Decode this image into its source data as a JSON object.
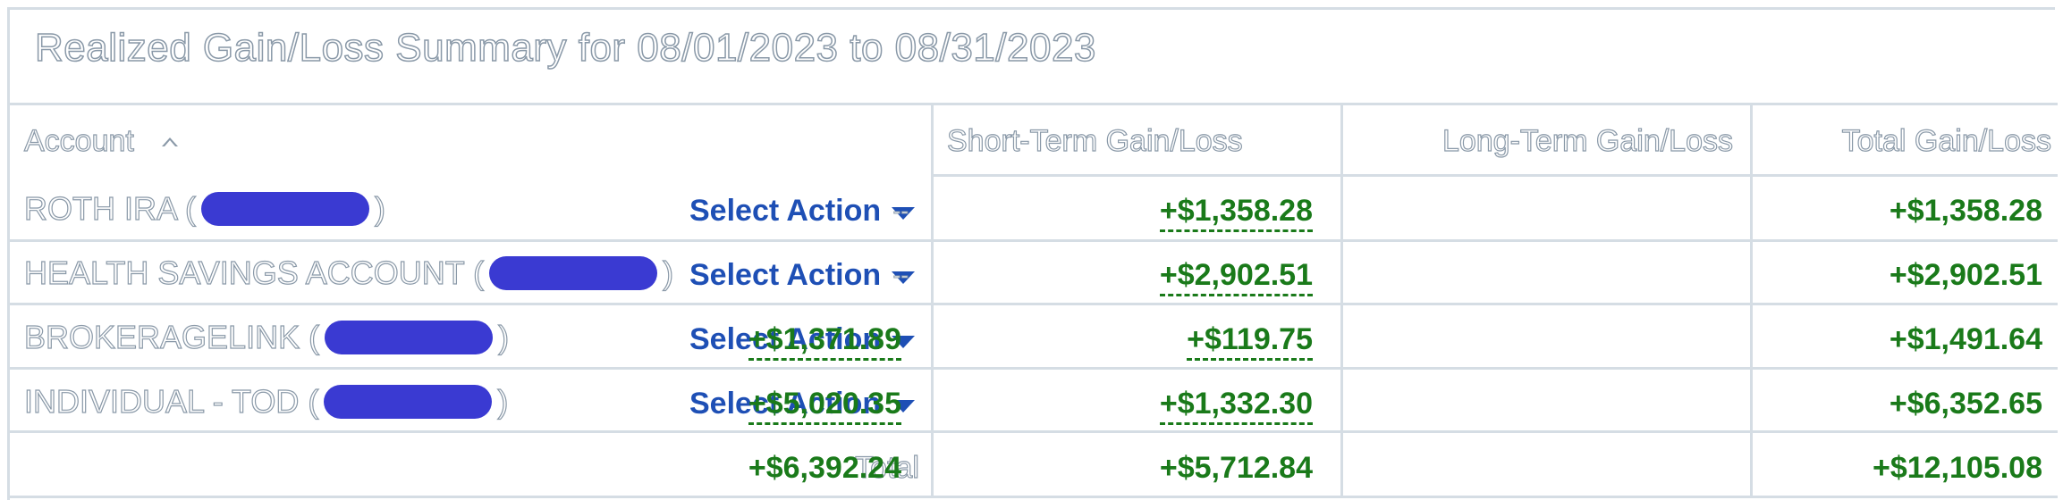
{
  "summary": {
    "title": "Realized Gain/Loss Summary for 08/01/2023 to 08/31/2023"
  },
  "table": {
    "headers": {
      "account": "Account",
      "short_term": "Short-Term Gain/Loss",
      "long_term": "Long-Term Gain/Loss",
      "total": "Total Gain/Loss"
    },
    "sort_icon": "caret-up-icon",
    "select_action_label": "Select Action",
    "rows": [
      {
        "account_name": "ROTH IRA (",
        "account_close": ")",
        "short_term": "--",
        "long_term": "+$1,358.28",
        "total": "+$1,358.28"
      },
      {
        "account_name": "HEALTH SAVINGS ACCOUNT (",
        "account_close": ")",
        "short_term": "--",
        "long_term": "+$2,902.51",
        "total": "+$2,902.51"
      },
      {
        "account_name": "BROKERAGELINK (",
        "account_close": ")",
        "short_term": "+$1,371.89",
        "long_term": "+$119.75",
        "total": "+$1,491.64"
      },
      {
        "account_name": "INDIVIDUAL - TOD (",
        "account_close": ")",
        "short_term": "+$5,020.35",
        "long_term": "+$1,332.30",
        "total": "+$6,352.65"
      }
    ],
    "totals": {
      "label": "Total",
      "short_term": "+$6,392.24",
      "long_term": "+$5,712.84",
      "total": "+$12,105.08"
    }
  },
  "colors": {
    "gain": "#1a7a1a",
    "link": "#1e4fb5",
    "redaction": "#3a3ad2",
    "border": "#d5dde4"
  }
}
